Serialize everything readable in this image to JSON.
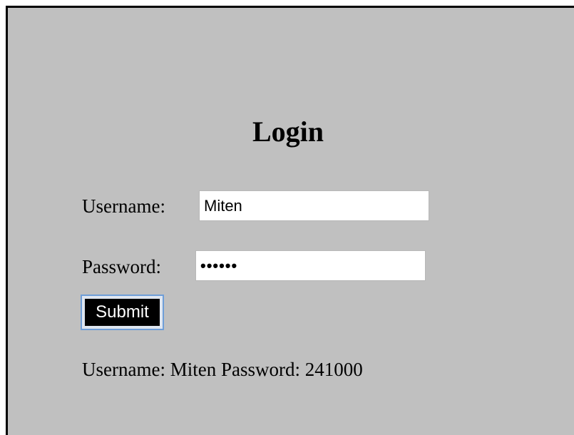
{
  "login": {
    "title": "Login",
    "username_label": "Username:",
    "username_value": "Miten",
    "password_label": "Password:",
    "password_value": "241000",
    "submit_label": "Submit"
  },
  "result": {
    "username_label": "Username:",
    "username_value": "Miten",
    "password_label": "Password:",
    "password_value": "241000"
  }
}
